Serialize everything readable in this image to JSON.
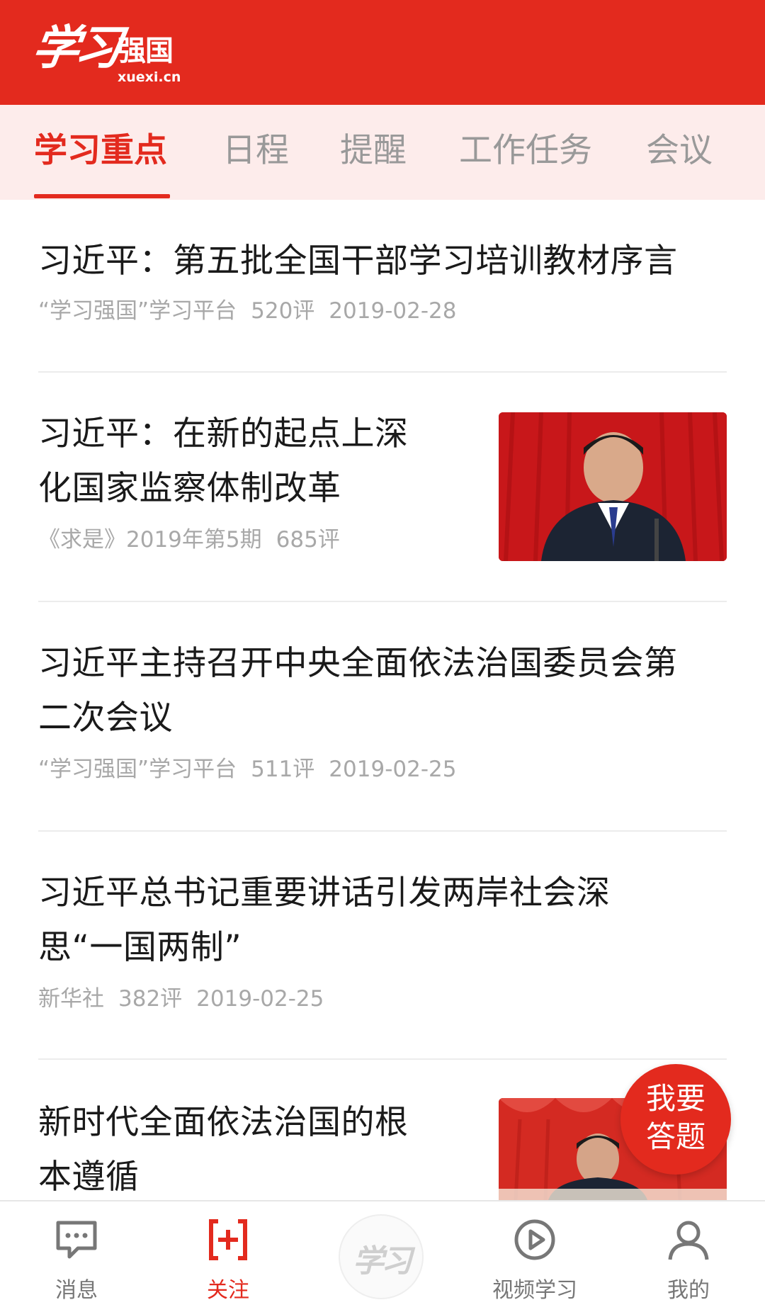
{
  "header": {
    "logo_mark": "学习",
    "logo_name": "强国",
    "logo_domain": "xuexi.cn",
    "bg_color": "#e32a1e"
  },
  "tabs": [
    {
      "label": "学习重点",
      "active": true
    },
    {
      "label": "日程",
      "active": false
    },
    {
      "label": "提醒",
      "active": false
    },
    {
      "label": "工作任务",
      "active": false
    },
    {
      "label": "会议",
      "active": false
    }
  ],
  "articles": [
    {
      "title_lines": [
        "习近平：第五批全国干部学习培训教材序言"
      ],
      "source": "“学习强国”学习平台",
      "comments": "520评",
      "date": "2019-02-28",
      "has_thumbnail": false
    },
    {
      "title_lines": [
        "习近平：在新的起点上深",
        "化国家监察体制改革"
      ],
      "source": "《求是》2019年第5期",
      "comments": "685评",
      "date": "",
      "has_thumbnail": true
    },
    {
      "title_lines": [
        "习近平主持召开中央全面依法治国委员会第",
        "二次会议"
      ],
      "source": "“学习强国”学习平台",
      "comments": "511评",
      "date": "2019-02-25",
      "has_thumbnail": false
    },
    {
      "title_lines": [
        "习近平总书记重要讲话引发两岸社会深",
        "思“一国两制”"
      ],
      "source": "新华社",
      "comments": "382评",
      "date": "2019-02-25",
      "has_thumbnail": false
    },
    {
      "title_lines": [
        "新时代全面依法治国的根",
        "本遵循"
      ],
      "source": "",
      "comments": "",
      "date": "",
      "has_thumbnail": true
    }
  ],
  "answer_button": {
    "line1": "我要",
    "line2": "答题"
  },
  "bottom_nav": [
    {
      "label": "消息",
      "icon": "message-icon",
      "active": false
    },
    {
      "label": "关注",
      "icon": "follow-plus-icon",
      "active": true
    },
    {
      "label": "",
      "icon": "xuexi-center-logo",
      "mark": "学习",
      "active": false
    },
    {
      "label": "视频学习",
      "icon": "video-play-icon",
      "active": false
    },
    {
      "label": "我的",
      "icon": "profile-icon",
      "active": false
    }
  ],
  "colors": {
    "accent": "#e32a1e",
    "tab_bg": "#fdeceb",
    "meta": "#a8a8a8"
  }
}
